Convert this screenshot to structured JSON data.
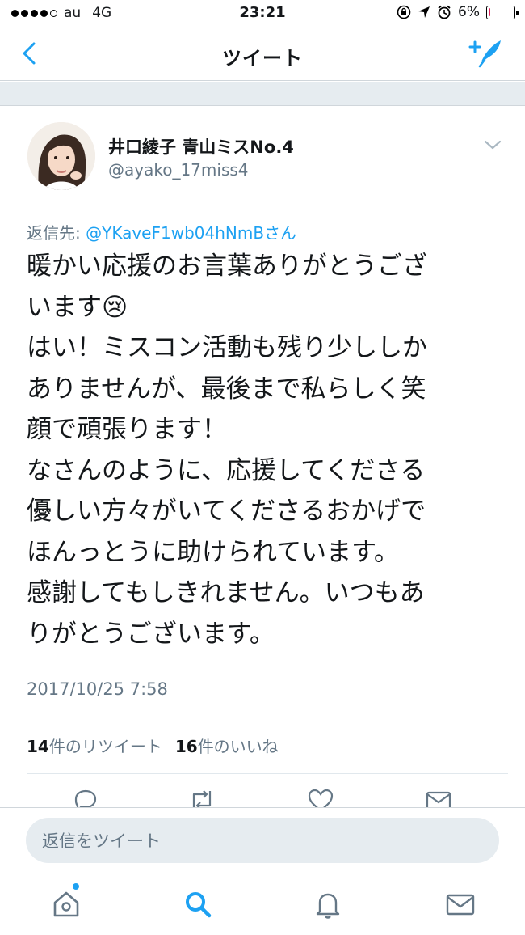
{
  "status_bar": {
    "carrier": "au",
    "network": "4G",
    "time": "23:21",
    "battery": "6%",
    "battery_level": 0.06
  },
  "nav": {
    "title": "ツイート",
    "back_icon": "chevron-left-icon",
    "compose_icon": "compose-tweet-icon"
  },
  "tweet": {
    "author": {
      "display_name": "井口綾子 青山ミスNo.4",
      "handle": "@ayako_17miss4"
    },
    "reply_prefix": "返信先: ",
    "reply_to": "@YKaveF1wb04hNmBさん",
    "body_lines": [
      "暖かい応援のお言葉ありがとうござ",
      "います😢",
      "はい！ミスコン活動も残り少ししか",
      "ありませんが、最後まで私らしく笑",
      "顔で頑張ります！",
      "なさんのように、応援してくださる",
      "優しい方々がいてくださるおかげで",
      "ほんっとうに助けられています。",
      "感謝してもしきれません。いつもあ",
      "りがとうございます。"
    ],
    "timestamp": "2017/10/25 7:58",
    "retweets_count": "14",
    "retweets_label": "件のリツイート",
    "likes_count": "16",
    "likes_label": "件のいいね"
  },
  "composer": {
    "placeholder": "返信をツイート"
  },
  "colors": {
    "accent": "#1da1f2",
    "muted": "#657786",
    "band": "#e6ecf0"
  }
}
